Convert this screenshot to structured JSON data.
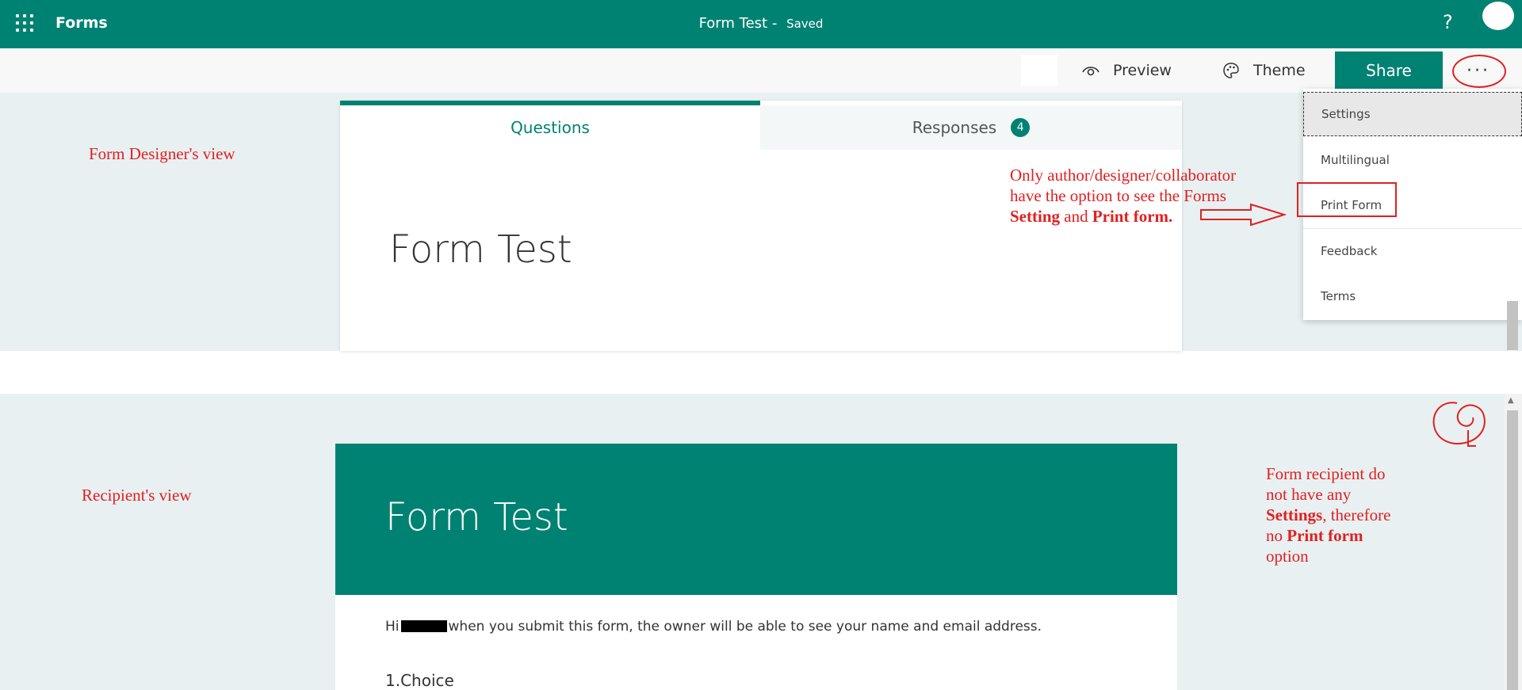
{
  "app": {
    "name": "Forms",
    "title": "Form Test",
    "status": "Saved",
    "help_glyph": "?"
  },
  "toolbar": {
    "preview_label": "Preview",
    "theme_label": "Theme",
    "share_label": "Share",
    "more_glyph": "···"
  },
  "designer": {
    "tabs": [
      {
        "label": "Questions",
        "active": true
      },
      {
        "label": "Responses",
        "badge": "4"
      }
    ],
    "form_title": "Form Test"
  },
  "menu": {
    "items": [
      {
        "label": "Settings"
      },
      {
        "label": "Multilingual"
      },
      {
        "label": "Print Form"
      },
      {
        "label": "Feedback"
      },
      {
        "label": "Terms"
      }
    ]
  },
  "annotations": {
    "designer_view": "Form Designer's view",
    "recipient_view": "Recipient's view",
    "author_note": {
      "line1": "Only author/designer/collaborator",
      "line2": "have the option to see the Forms",
      "bold1": "Setting",
      "and": "and",
      "bold2": "Print form."
    },
    "recipient_note": {
      "line1": "Form recipient do",
      "line2": "not have any",
      "bold1": "Settings",
      "therefore": ", therefore",
      "no": "no",
      "bold2": "Print form",
      "option": "option"
    }
  },
  "recipient": {
    "form_title": "Form Test",
    "notice_prefix": "Hi",
    "notice_suffix": "when you submit this form, the owner will be able to see your name and email address.",
    "question": "1.Choice"
  },
  "colors": {
    "brand": "#008272",
    "annotation": "#e02020",
    "canvas": "#e9f0f2"
  }
}
